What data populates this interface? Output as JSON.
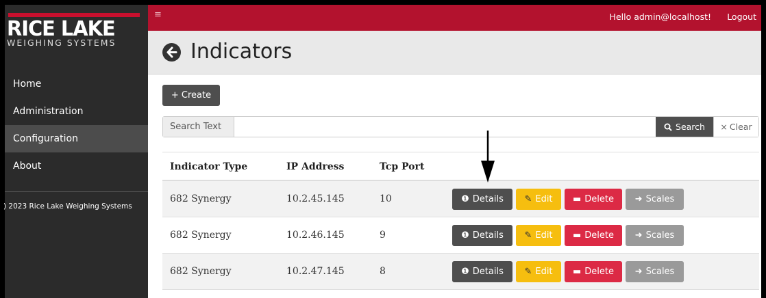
{
  "brand": {
    "name": "RICE LAKE",
    "tagline": "WEIGHING SYSTEMS"
  },
  "sidebar": {
    "items": [
      {
        "label": "Home"
      },
      {
        "label": "Administration"
      },
      {
        "label": "Configuration"
      },
      {
        "label": "About"
      }
    ],
    "active": "Configuration",
    "copyright": ") 2023 Rice Lake Weighing Systems"
  },
  "topbar": {
    "menu_icon": "≡",
    "greeting": "Hello admin@localhost!",
    "logout": "Logout"
  },
  "header": {
    "title": "Indicators",
    "back_icon": "arrow-left-circle-icon"
  },
  "toolbar": {
    "create_label": "+ Create"
  },
  "search": {
    "prefix": "Search Text",
    "value": "",
    "search_label": "Search",
    "clear_label": "Clear"
  },
  "table": {
    "columns": [
      "Indicator Type",
      "IP Address",
      "Tcp Port"
    ],
    "rows": [
      {
        "type": "682 Synergy",
        "ip": "10.2.45.145",
        "port": "10"
      },
      {
        "type": "682 Synergy",
        "ip": "10.2.46.145",
        "port": "9"
      },
      {
        "type": "682 Synergy",
        "ip": "10.2.47.145",
        "port": "8"
      }
    ],
    "actions": {
      "details": "Details",
      "edit": "Edit",
      "delete": "Delete",
      "scales": "Scales"
    }
  },
  "colors": {
    "topbar": "#b3122e",
    "sidebar": "#2b2b2b",
    "details": "#4e4e4e",
    "edit": "#f6be0f",
    "delete": "#dc2a45",
    "scales": "#9a9a9a"
  }
}
